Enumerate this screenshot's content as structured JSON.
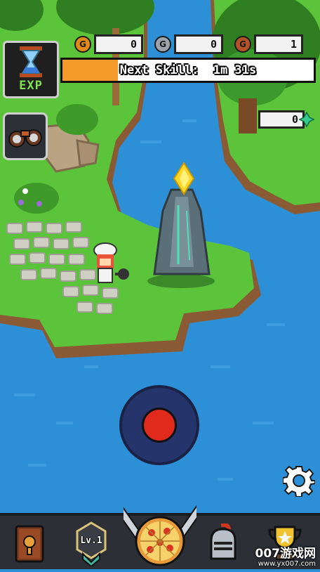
{
  "hud": {
    "currencies": [
      {
        "icon": "gold-coin-icon",
        "glyph": "G",
        "value": "0",
        "color": "#e08a1e"
      },
      {
        "icon": "silver-coin-icon",
        "glyph": "G",
        "value": "0",
        "color": "#9ea4ad"
      },
      {
        "icon": "bronze-coin-icon",
        "glyph": "G",
        "value": "1",
        "color": "#b4532a"
      }
    ],
    "exp_label": "EXP",
    "next_skill_label": "Next Skill:",
    "next_skill_timer": "1m 31s",
    "skill_progress": 0.22,
    "gem_count": "0"
  },
  "bottom_nav": {
    "level_label": "Lv.1"
  },
  "watermark": {
    "line1": "007游戏网",
    "line2": "www.yx007.com"
  },
  "colors": {
    "water": "#2d8fd6",
    "grass": "#5cc43a",
    "accent_orange": "#f39a2b",
    "joystick_knob": "#e02b1c"
  }
}
